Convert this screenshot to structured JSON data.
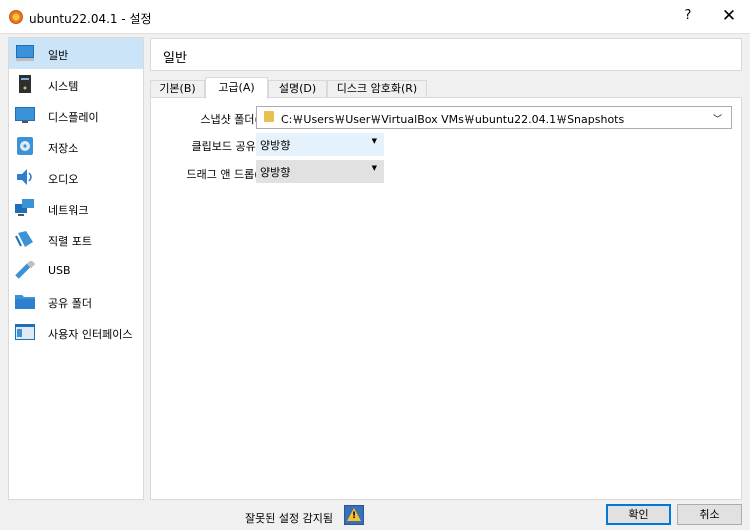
{
  "window": {
    "title": "ubuntu22.04.1 - 설정",
    "help": "?",
    "close": "✕"
  },
  "sidebar": {
    "items": [
      {
        "label": "일반",
        "icon": "general-icon"
      },
      {
        "label": "시스템",
        "icon": "system-icon"
      },
      {
        "label": "디스플레이",
        "icon": "display-icon"
      },
      {
        "label": "저장소",
        "icon": "storage-icon"
      },
      {
        "label": "오디오",
        "icon": "audio-icon"
      },
      {
        "label": "네트워크",
        "icon": "network-icon"
      },
      {
        "label": "직렬 포트",
        "icon": "serial-port-icon"
      },
      {
        "label": "USB",
        "icon": "usb-icon"
      },
      {
        "label": "공유 폴더",
        "icon": "shared-folder-icon"
      },
      {
        "label": "사용자 인터페이스",
        "icon": "user-interface-icon"
      }
    ],
    "selected": "일반"
  },
  "header": {
    "title": "일반"
  },
  "tabs": [
    "기본(B)",
    "고급(A)",
    "설명(D)",
    "디스크 암호화(R)"
  ],
  "active_tab": "고급(A)",
  "advanced": {
    "snapshot_label": "스냅샷 폴더(N):",
    "snapshot_path": "C:￦Users￦User￦VirtualBox VMs￦ubuntu22.04.1￦Snapshots",
    "clipboard_label": "클립보드 공유(S):",
    "clipboard_value": "양방향",
    "dragdrop_label": "드래그 앤 드롭(D):",
    "dragdrop_value": "양방향"
  },
  "footer": {
    "status": "잘못된 설정 감지됨",
    "ok": "확인",
    "cancel": "취소"
  },
  "colors": {
    "selected_bg": "#cce4f7",
    "clipboard_bg": "#e5f1fb",
    "dragdrop_bg": "#e1e1e1",
    "primary_border": "#0078d7"
  }
}
